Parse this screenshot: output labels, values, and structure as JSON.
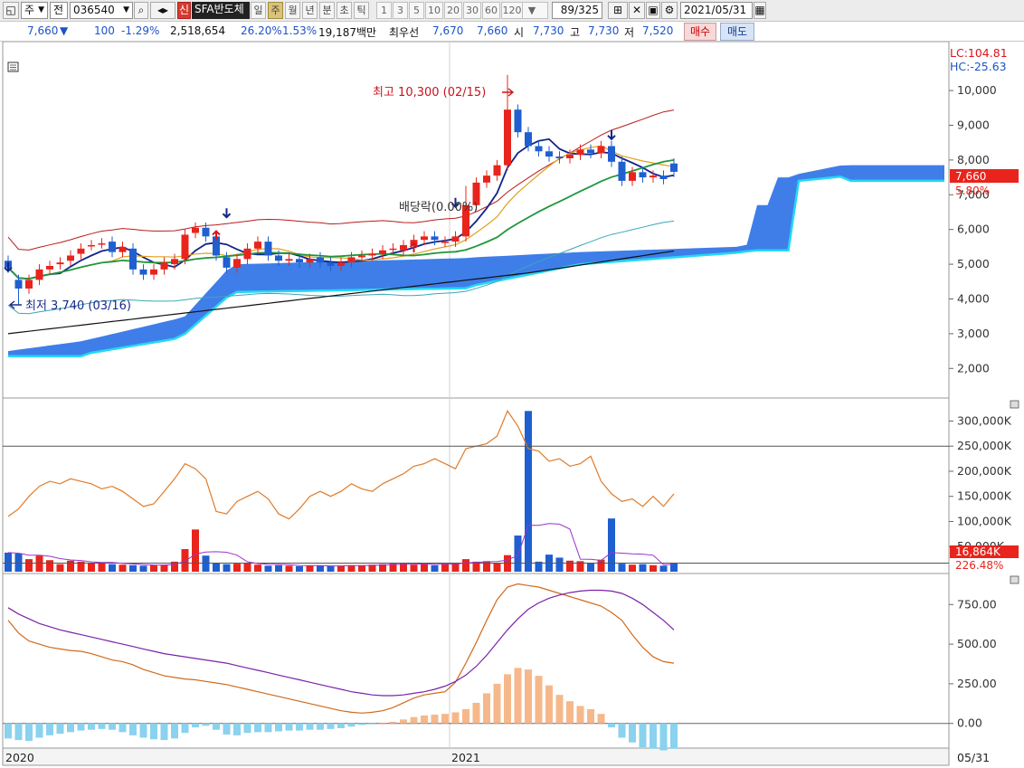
{
  "toolbar": {
    "period_type": "주",
    "market": "전",
    "code": "036540",
    "name_badge": "신",
    "name": "SFA반도체",
    "periods": [
      {
        "label": "일",
        "active": false
      },
      {
        "label": "주",
        "active": true
      },
      {
        "label": "월",
        "active": false
      },
      {
        "label": "년",
        "active": false
      },
      {
        "label": "분",
        "active": false
      },
      {
        "label": "초",
        "active": false
      },
      {
        "label": "틱",
        "active": false
      }
    ],
    "intervals": [
      "1",
      "3",
      "5",
      "10",
      "20",
      "30",
      "60",
      "120"
    ],
    "count": "89/325",
    "date": "2021/05/31"
  },
  "quote": {
    "price": "7,660",
    "change": "100",
    "change_pct": "-1.29%",
    "volume": "2,518,654",
    "volume_ratio": "26.20%",
    "turnover": "1.53%",
    "amount": "19,187백만",
    "best_label": "최우선",
    "best_ask": "7,670",
    "best_bid": "7,660",
    "open_label": "시",
    "open": "7,730",
    "high_label": "고",
    "high": "7,730",
    "low_label": "저",
    "low": "7,520",
    "buy_label": "매수",
    "sell_label": "매도"
  },
  "colors": {
    "up": "#e8241c",
    "down": "#1f5fd0",
    "cloud": "#3f7ee8",
    "cloud_edge": "#24d8f6"
  },
  "chart_data": [
    {
      "type": "candlestick",
      "title": "price",
      "x": [
        "2020",
        "2021"
      ],
      "x_right_label": "05/31",
      "ylim": [
        1200,
        11200
      ],
      "y_ticks": [
        "10,000",
        "9,000",
        "8,000",
        "7,000",
        "6,000",
        "5,000",
        "4,000",
        "3,000",
        "2,000"
      ],
      "lc": "LC:104.81",
      "hc": "HC:-25.63",
      "last_price": "7,660",
      "last_pct": "5.80%",
      "annotations": {
        "high": "최고 10,300 (02/15)",
        "low": "최저 3,740 (03/16)",
        "dividend": "배당락(0.00%)"
      }
    },
    {
      "type": "bar",
      "title": "volume",
      "ylim": [
        0,
        335000
      ],
      "y_ticks": [
        "300,000K",
        "250,000K",
        "200,000K",
        "150,000K",
        "100,000K",
        "50,000K"
      ],
      "last_volume": "16,864K",
      "ratio": "226.48%"
    },
    {
      "type": "bar",
      "title": "oscillator",
      "ylim": [
        -150,
        900
      ],
      "y_ticks": [
        "750.00",
        "500.00",
        "250.00",
        "0.00"
      ]
    }
  ]
}
